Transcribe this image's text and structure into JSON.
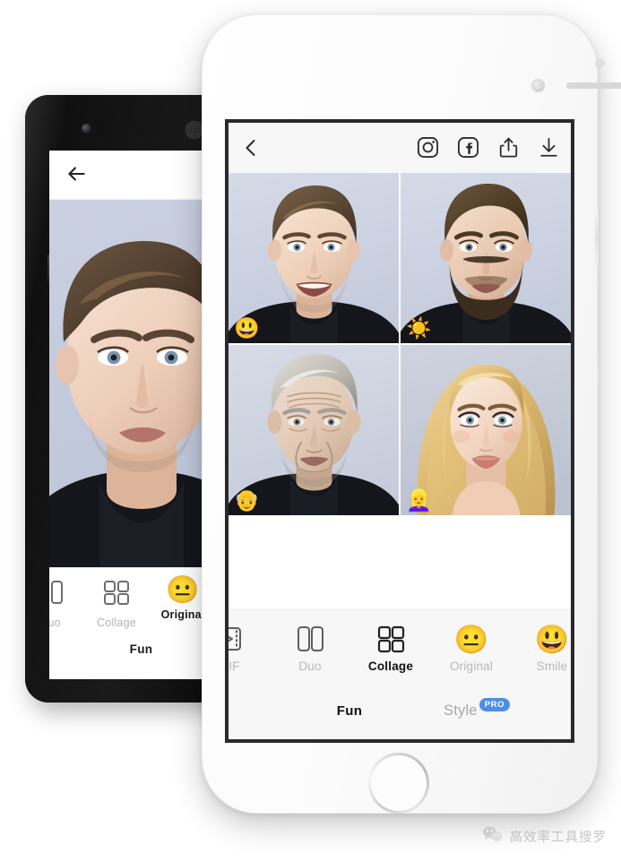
{
  "android": {
    "appbar": {
      "back_icon": "arrow-left-icon",
      "instagram_icon": "instagram-icon"
    },
    "toolbar": {
      "items": [
        {
          "label": "Duo",
          "icon": "duo-split-icon",
          "active": false
        },
        {
          "label": "Collage",
          "icon": "collage-grid-icon",
          "active": false
        },
        {
          "label": "Original",
          "icon": "neutral-face-emoji",
          "emoji": "😐",
          "active": true
        }
      ],
      "categories": [
        {
          "label": "Fun",
          "active": true
        }
      ]
    }
  },
  "iphone": {
    "appbar": {
      "back_icon": "chevron-left-icon",
      "actions": [
        {
          "name": "instagram-share-button",
          "icon": "instagram-icon"
        },
        {
          "name": "facebook-share-button",
          "icon": "facebook-icon"
        },
        {
          "name": "share-button",
          "icon": "share-upload-icon"
        },
        {
          "name": "download-button",
          "icon": "download-icon"
        }
      ]
    },
    "collage": {
      "cells": [
        {
          "name": "collage-cell-smile",
          "badge": "😃",
          "badge_name": "smiling-face-emoji",
          "subject": "young-man-smiling"
        },
        {
          "name": "collage-cell-beard",
          "badge": "☀️",
          "badge_name": "sun-emoji",
          "subject": "man-with-beard"
        },
        {
          "name": "collage-cell-old",
          "badge": "👴",
          "badge_name": "older-man-emoji",
          "subject": "old-man"
        },
        {
          "name": "collage-cell-female",
          "badge": "👱‍♀️",
          "badge_name": "blonde-woman-emoji",
          "subject": "blonde-woman"
        }
      ]
    },
    "toolbar": {
      "items": [
        {
          "label": "GIF",
          "icon": "gif-play-icon",
          "active": false
        },
        {
          "label": "Duo",
          "icon": "duo-split-icon",
          "active": false
        },
        {
          "label": "Collage",
          "icon": "collage-grid-icon",
          "active": true
        },
        {
          "label": "Original",
          "icon": "neutral-face-emoji",
          "emoji": "😐",
          "active": false
        },
        {
          "label": "Smile",
          "icon": "grinning-face-emoji",
          "emoji": "😃",
          "active": false
        }
      ],
      "categories": [
        {
          "label": "Fun",
          "active": true,
          "pro": false
        },
        {
          "label": "Style",
          "active": false,
          "pro": true,
          "pro_label": "PRO"
        }
      ]
    }
  },
  "watermark": {
    "text": "高效率工具搜罗",
    "icon": "wechat-logo-icon"
  },
  "colors": {
    "accent_blue": "#4a8ee8",
    "toolbar_bg": "#f7f7f7",
    "active_text": "#111111",
    "inactive_text": "#b8b8b8",
    "photo_bg": "#c9cede"
  }
}
